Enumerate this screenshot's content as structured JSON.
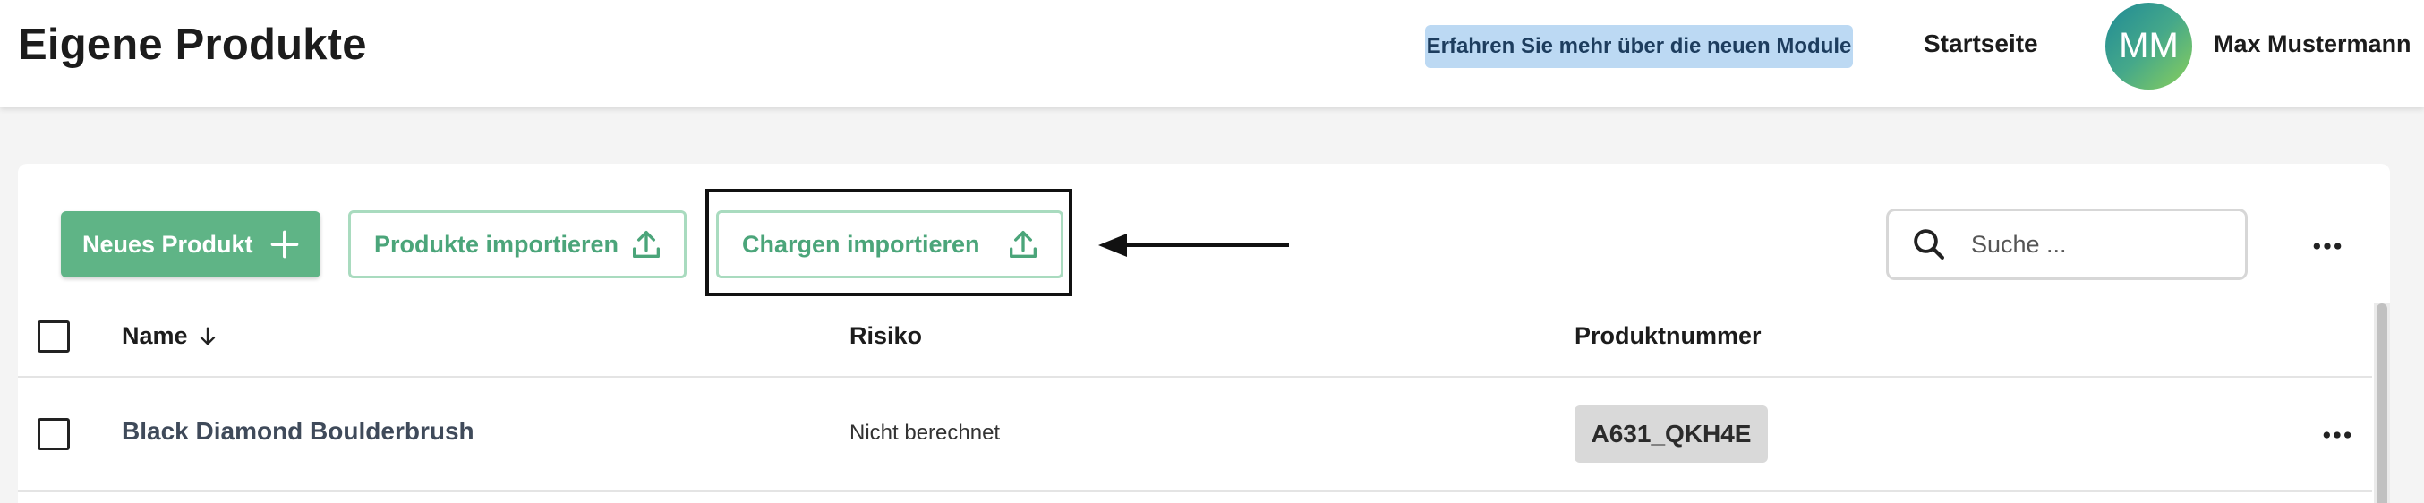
{
  "header": {
    "title": "Eigene Produkte",
    "info_badge": "Erfahren Sie mehr über die neuen Module",
    "nav_home": "Startseite",
    "avatar_initials": "MM",
    "user_name": "Max Mustermann"
  },
  "toolbar": {
    "new_product_label": "Neues Produkt",
    "import_products_label": "Produkte importieren",
    "import_batches_label": "Chargen importieren",
    "search_placeholder": "Suche ...",
    "icons": {
      "new_product": "plus-icon",
      "import": "upload-icon",
      "search": "search-icon",
      "more": "more-horizontal-icon"
    }
  },
  "table": {
    "columns": [
      {
        "label": "Name",
        "sort": "descending"
      },
      {
        "label": "Risiko"
      },
      {
        "label": "Produktnummer"
      }
    ],
    "rows": [
      {
        "name": "Black Diamond Boulderbrush",
        "risk": "Nicht berechnet",
        "product_number": "A631_QKH4E"
      }
    ]
  },
  "colors": {
    "accent_green": "#5fb486",
    "accent_green_text": "#4ba57a",
    "outline_green": "#a9dbbf",
    "info_badge_bg": "#bcd9f3",
    "chip_bg": "#d9d9d9",
    "page_bg": "#f4f4f4"
  }
}
